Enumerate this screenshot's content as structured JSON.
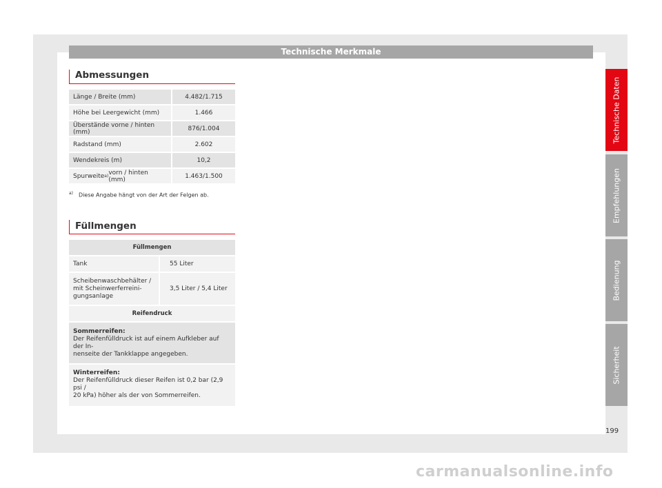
{
  "header": {
    "title": "Technische Merkmale"
  },
  "abmessungen": {
    "title": "Abmessungen",
    "rows": [
      {
        "label": "Länge / Breite (mm)",
        "value": "4.482/1.715"
      },
      {
        "label": "Höhe bei Leergewicht (mm)",
        "value": "1.466"
      },
      {
        "label": "Überstände vorne / hinten (mm)",
        "value": "876/1.004"
      },
      {
        "label": "Radstand (mm)",
        "value": "2.602"
      },
      {
        "label": "Wendekreis (m)",
        "value": "10,2"
      },
      {
        "label_pre": "Spurweite",
        "label_sup": "a)",
        "label_post": " vorn / hinten (mm)",
        "value": "1.463/1.500"
      }
    ],
    "footnote_mark": "a)",
    "footnote": "Diese Angabe hängt von der Art der Felgen ab."
  },
  "fuellmengen": {
    "title": "Füllmengen",
    "table_head": "Füllmengen",
    "tank_label": "Tank",
    "tank_value": "55 Liter",
    "wash_label_1": "Scheibenwaschbehälter /",
    "wash_label_2": "mit Scheinwerferreini-",
    "wash_label_3": "gungsanlage",
    "wash_value": "3,5 Liter / 5,4 Liter",
    "reifen_head": "Reifendruck",
    "sommer_title": "Sommerreifen:",
    "sommer_line1": "Der Reifenfülldruck ist auf einem Aufkleber auf der In-",
    "sommer_line2": "nenseite der Tankklappe angegeben.",
    "winter_title": "Winterreifen:",
    "winter_line1": "Der Reifenfülldruck dieser Reifen ist 0,2 bar (2,9 psi /",
    "winter_line2": "20 kPa) höher als der von Sommerreifen."
  },
  "tabs": {
    "technische_daten": "Technische Daten",
    "empfehlungen": "Empfehlungen",
    "bedienung": "Bedienung",
    "sicherheit": "Sicherheit"
  },
  "colors": {
    "accent": "#e30613",
    "tab_gray": "#a6a6a6"
  },
  "page_number": "199",
  "watermark": "carmanualsonline.info"
}
